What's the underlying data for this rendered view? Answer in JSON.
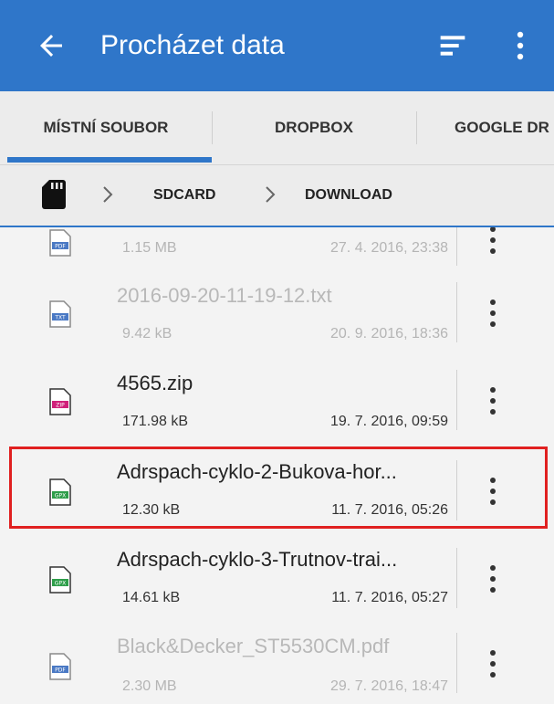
{
  "appbar": {
    "title": "Procházet data",
    "back_icon": "arrow-left-icon",
    "sort_icon": "sort-icon",
    "more_icon": "more-vert-icon",
    "color": "#2f76c9"
  },
  "tabs": [
    {
      "label": "MÍSTNÍ SOUBOR",
      "active": true
    },
    {
      "label": "DROPBOX",
      "active": false
    },
    {
      "label": "GOOGLE DR",
      "active": false
    }
  ],
  "breadcrumb": {
    "root_icon": "sd-card-icon",
    "items": [
      "SDCARD",
      "DOWNLOAD"
    ]
  },
  "files": [
    {
      "name": "",
      "size": "1.15 MB",
      "date": "27. 4. 2016, 23:38",
      "type": "PDF",
      "dim": true
    },
    {
      "name": "2016-09-20-11-19-12.txt",
      "size": "9.42 kB",
      "date": "20. 9. 2016, 18:36",
      "type": "TXT",
      "dim": true
    },
    {
      "name": "4565.zip",
      "size": "171.98 kB",
      "date": "19. 7. 2016, 09:59",
      "type": "ZIP",
      "dim": false
    },
    {
      "name": "Adrspach-cyklo-2-Bukova-hor...",
      "size": "12.30 kB",
      "date": "11. 7. 2016, 05:26",
      "type": "GPX",
      "dim": false,
      "highlighted": true
    },
    {
      "name": "Adrspach-cyklo-3-Trutnov-trai...",
      "size": "14.61 kB",
      "date": "11. 7. 2016, 05:27",
      "type": "GPX",
      "dim": false
    },
    {
      "name": "Black&Decker_ST5530CM.pdf",
      "size": "2.30 MB",
      "date": "29. 7. 2016, 18:47",
      "type": "PDF",
      "dim": true
    }
  ],
  "colors": {
    "highlight": "#e02020",
    "gpx": "#2e9e4a",
    "zip": "#d0207a",
    "pdf": "#4a79c4",
    "txt": "#4a79c4"
  }
}
